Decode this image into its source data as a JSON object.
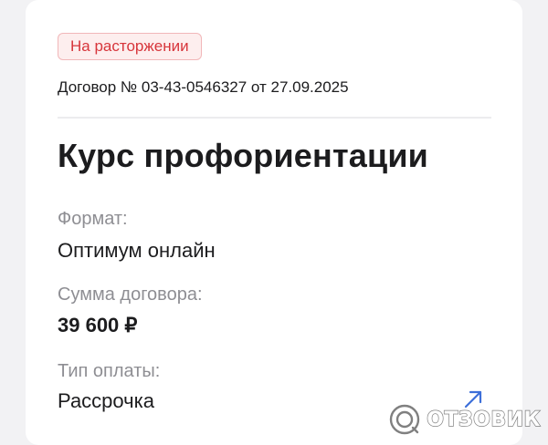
{
  "contract": {
    "status": "На расторжении",
    "line": "Договор № 03-43-0546327 от 27.09.2025"
  },
  "course": {
    "title": "Курс профориентации"
  },
  "fields": {
    "format_label": "Формат:",
    "format_value": "Оптимум онлайн",
    "sum_label": "Сумма договора:",
    "sum_value": "39 600 ₽",
    "payment_label": "Тип оплаты:",
    "payment_value": "Рассрочка"
  },
  "icons": {
    "open": "arrow-up-right-icon"
  },
  "watermark": {
    "text": "ОТЗОВИК"
  },
  "colors": {
    "status_text": "#d7353b",
    "status_bg": "#fdeeee",
    "status_border": "#f1b7b9",
    "accent": "#3d6fd9"
  }
}
